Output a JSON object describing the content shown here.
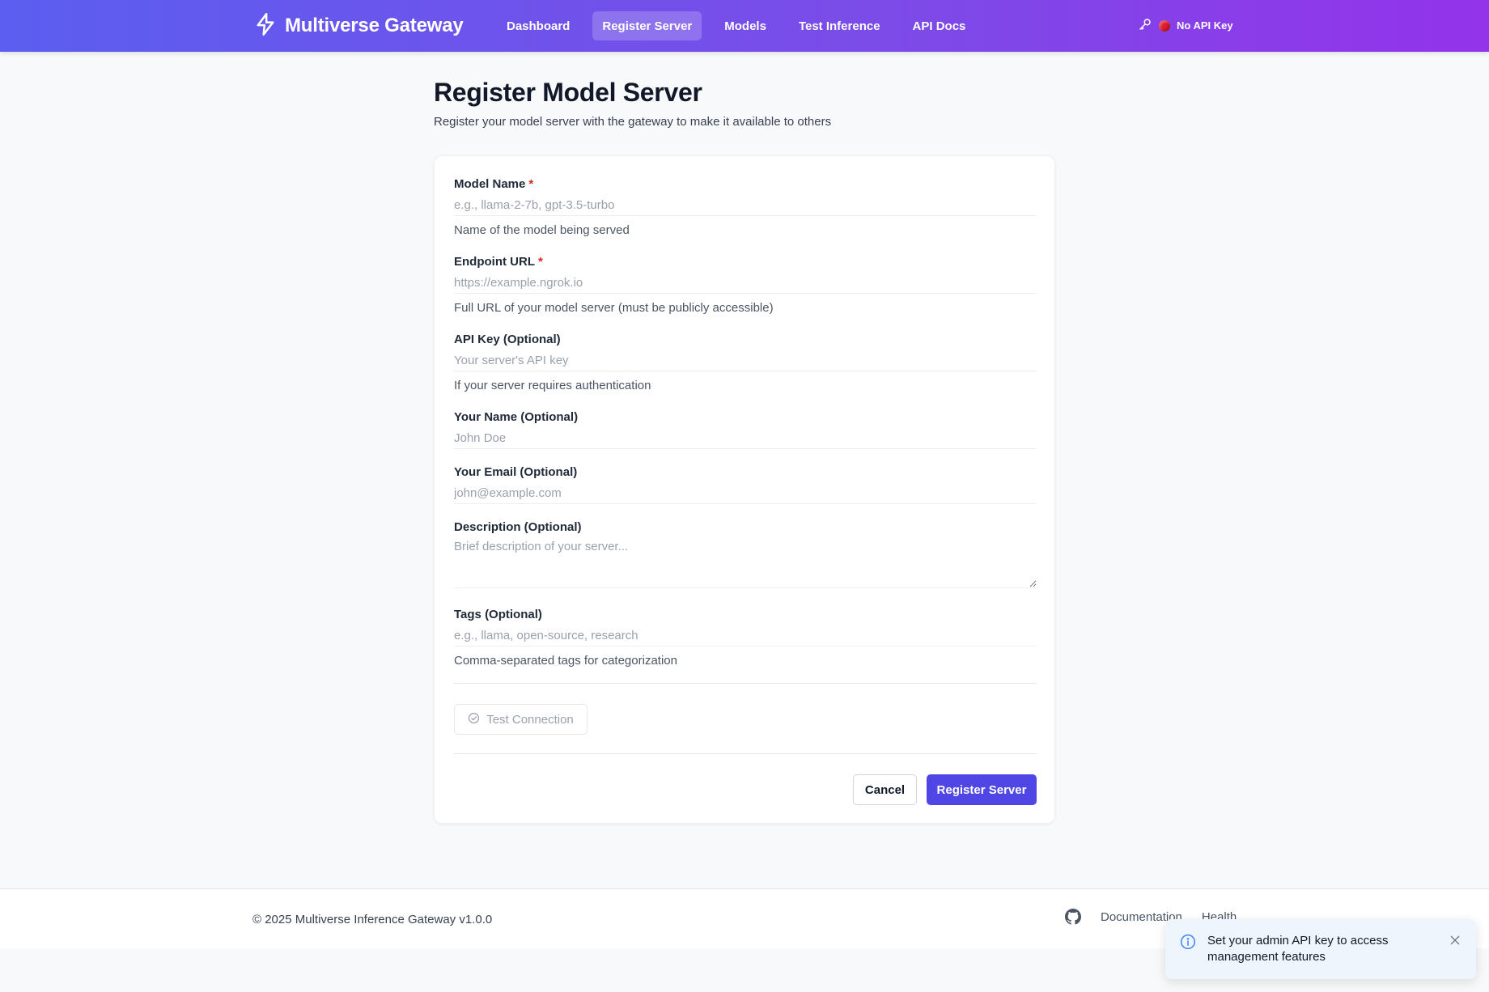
{
  "navbar": {
    "brand": "Multiverse Gateway",
    "links": [
      "Dashboard",
      "Register Server",
      "Models",
      "Test Inference",
      "API Docs"
    ],
    "active_index": 1,
    "api_status": "No API Key"
  },
  "page": {
    "title": "Register Model Server",
    "subtitle": "Register your model server with the gateway to make it available to others"
  },
  "form": {
    "model_name": {
      "label": "Model Name",
      "required_mark": "*",
      "placeholder": "e.g., llama-2-7b, gpt-3.5-turbo",
      "value": "",
      "help": "Name of the model being served"
    },
    "endpoint_url": {
      "label": "Endpoint URL",
      "required_mark": "*",
      "placeholder": "https://example.ngrok.io",
      "value": "",
      "help": "Full URL of your model server (must be publicly accessible)"
    },
    "api_key": {
      "label": "API Key (Optional)",
      "placeholder": "Your server's API key",
      "value": "",
      "help": "If your server requires authentication"
    },
    "your_name": {
      "label": "Your Name (Optional)",
      "placeholder": "John Doe",
      "value": ""
    },
    "your_email": {
      "label": "Your Email (Optional)",
      "placeholder": "john@example.com",
      "value": ""
    },
    "description": {
      "label": "Description (Optional)",
      "placeholder": "Brief description of your server...",
      "value": ""
    },
    "tags": {
      "label": "Tags (Optional)",
      "placeholder": "e.g., llama, open-source, research",
      "value": "",
      "help": "Comma-separated tags for categorization"
    },
    "test_button": "Test Connection",
    "cancel_button": "Cancel",
    "submit_button": "Register Server"
  },
  "footer": {
    "copyright": "© 2025 Multiverse Inference Gateway v1.0.0",
    "links": [
      "Documentation",
      "Health"
    ]
  },
  "toast": {
    "message": "Set your admin API key to access management features"
  },
  "colors": {
    "nav_gradient_start": "#5b5ef0",
    "nav_gradient_end": "#9333ea",
    "primary": "#4f46e5",
    "required": "#dc2626",
    "status_dot": "#e11d2e",
    "toast_bg": "#eef5fc",
    "toast_icon": "#3b82f6"
  }
}
